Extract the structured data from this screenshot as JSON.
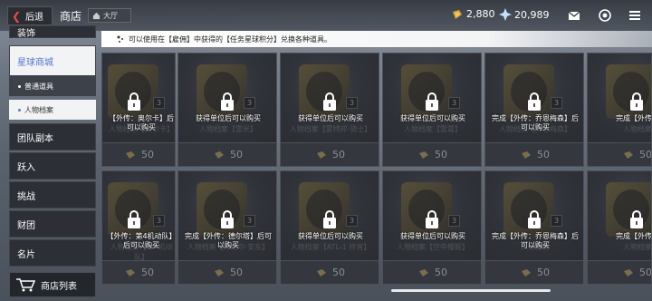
{
  "topbar": {
    "back_label": "后退",
    "page_title": "商店",
    "hall_label": "大厅",
    "currency_gold": "2,880",
    "currency_gem": "20,989"
  },
  "sidebar": {
    "items": [
      {
        "label": "装饰"
      },
      {
        "label": "星球商城"
      },
      {
        "label": "普通道具"
      },
      {
        "label": "人物档案"
      },
      {
        "label": "团队副本"
      },
      {
        "label": "跃入"
      },
      {
        "label": "挑战"
      },
      {
        "label": "财团"
      },
      {
        "label": "名片"
      }
    ],
    "shop_list_label": "商店列表"
  },
  "notice": {
    "text": "可以使用在【雇佣】中获得的【任务星球积分】兑换各种道具。"
  },
  "cards": [
    {
      "lock_text": "【外传：奥尔卡】后可以购买",
      "ghost": "人物档案【奥尔卡】",
      "badge": "3",
      "price": "50"
    },
    {
      "lock_text": "获得单位后可以购买",
      "ghost": "人物档案【雷米】",
      "badge": "3",
      "price": "50"
    },
    {
      "lock_text": "获得单位后可以购买",
      "ghost": "人物档案【蒙特邦·骑士】",
      "badge": "3",
      "price": "50"
    },
    {
      "lock_text": "获得单位后可以购买",
      "ghost": "人物档案【雷霆】",
      "badge": "3",
      "price": "50"
    },
    {
      "lock_text": "完成【外传：乔恩梅森】后可以购买",
      "ghost": "人物档案【乔恩梅森】",
      "badge": "3",
      "price": "50"
    },
    {
      "lock_text": "完成【外传：",
      "ghost": "人物档案",
      "badge": "3",
      "price": "50"
    },
    {
      "lock_text": "【外传：第4机动队】后可以购买",
      "ghost": "人物档案【第4机动队】",
      "badge": "3",
      "price": "50"
    },
    {
      "lock_text": "完成【外传：德尔塔】后可以购买",
      "ghost": "人物档案【丹尼尔·安东】",
      "badge": "3",
      "price": "50"
    },
    {
      "lock_text": "获得单位后可以购买",
      "ghost": "人物档案【ATL-1 祥宵】",
      "badge": "3",
      "price": "50"
    },
    {
      "lock_text": "获得单位后可以购买",
      "ghost": "人物档案【空中樱姬】",
      "badge": "3",
      "price": "50"
    },
    {
      "lock_text": "完成【外传：乔恩梅森】后可以购买",
      "ghost": "人物档案",
      "badge": "3",
      "price": "50"
    },
    {
      "lock_text": "完成【外传：",
      "ghost": "人物档案",
      "badge": "3",
      "price": "50"
    }
  ]
}
